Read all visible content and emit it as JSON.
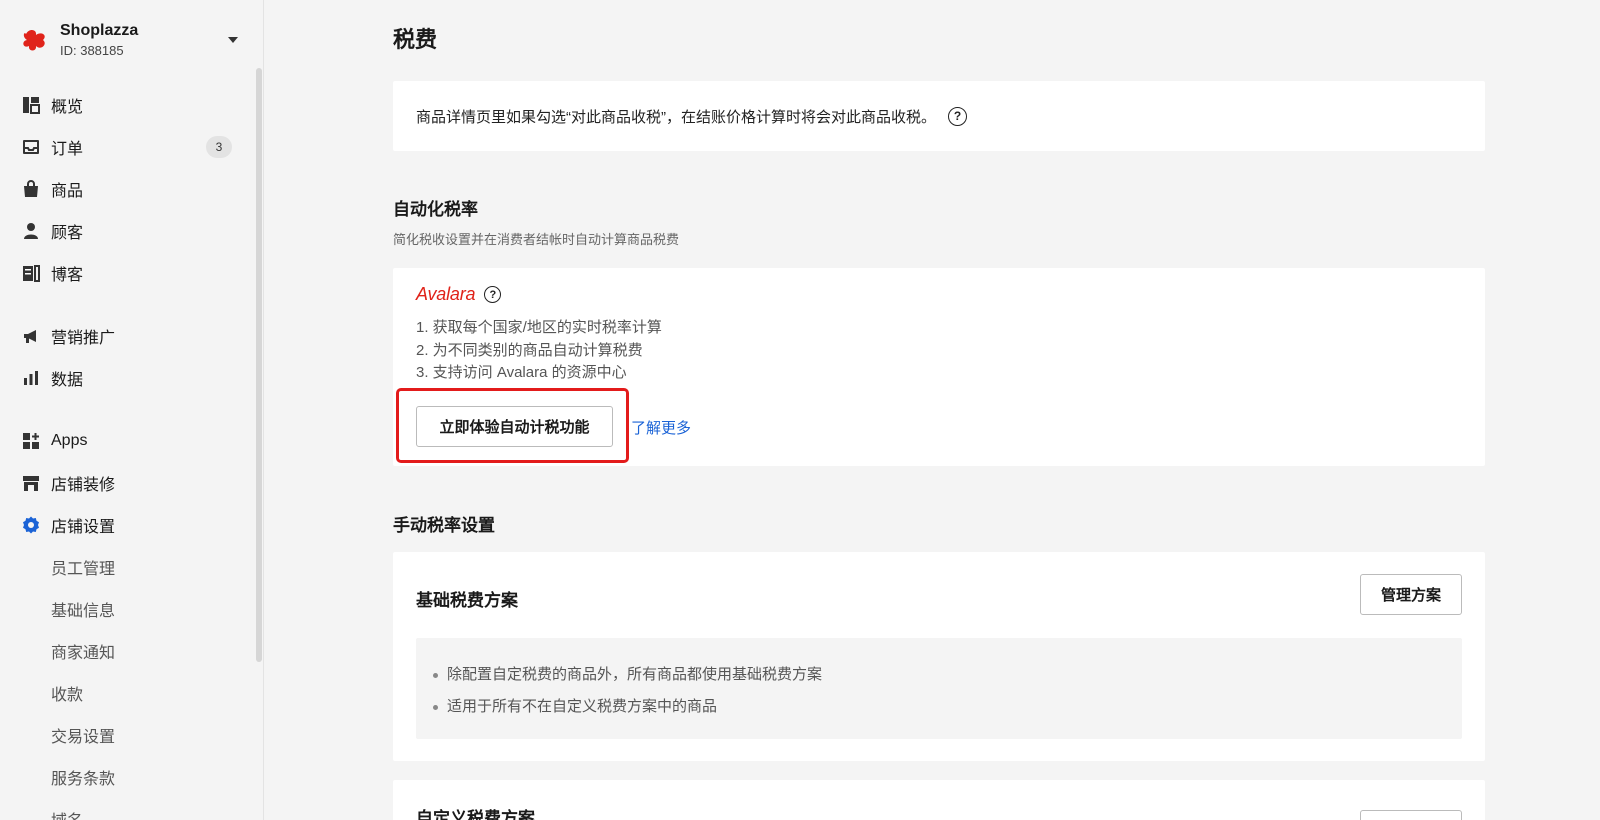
{
  "store": {
    "name": "Shoplazza",
    "id_text": "ID: 388185"
  },
  "nav": {
    "items": [
      {
        "label": "概览",
        "icon": "dashboard-icon"
      },
      {
        "label": "订单",
        "icon": "inbox-icon",
        "badge": "3"
      },
      {
        "label": "商品",
        "icon": "shopping-bag-icon"
      },
      {
        "label": "顾客",
        "icon": "person-icon"
      },
      {
        "label": "博客",
        "icon": "blog-icon"
      },
      {
        "label": "营销推广",
        "icon": "megaphone-icon"
      },
      {
        "label": "数据",
        "icon": "bar-chart-icon"
      },
      {
        "label": "Apps",
        "icon": "apps-icon"
      },
      {
        "label": "店铺装修",
        "icon": "storefront-icon"
      },
      {
        "label": "店铺设置",
        "icon": "gear-icon",
        "active": true
      }
    ],
    "sub_items": [
      "员工管理",
      "基础信息",
      "商家通知",
      "收款",
      "交易设置",
      "服务条款",
      "域名"
    ],
    "active_color": "#1b63d6"
  },
  "page": {
    "title": "税费",
    "notice": "商品详情页里如果勾选“对此商品收税”，在结账价格计算时将会对此商品收税。"
  },
  "auto": {
    "title": "自动化税率",
    "subtitle": "简化税收设置并在消费者结帐时自动计算商品税费",
    "brand": "Avalara",
    "features": [
      "1. 获取每个国家/地区的实时税率计算",
      "2. 为不同类别的商品自动计算税费",
      "3. 支持访问 Avalara 的资源中心"
    ],
    "try_button": "立即体验自动计税功能",
    "learn_more": "了解更多"
  },
  "manual": {
    "title": "手动税率设置",
    "basic": {
      "title": "基础税费方案",
      "button": "管理方案",
      "bullets": [
        "除配置自定税费的商品外，所有商品都使用基础税费方案",
        "适用于所有不在自定义税费方案中的商品"
      ]
    },
    "custom": {
      "title": "自定义税费方案"
    }
  },
  "colors": {
    "brand_red": "#e0231a",
    "link_blue": "#1b63d6",
    "highlight_red": "#e31b1b"
  }
}
